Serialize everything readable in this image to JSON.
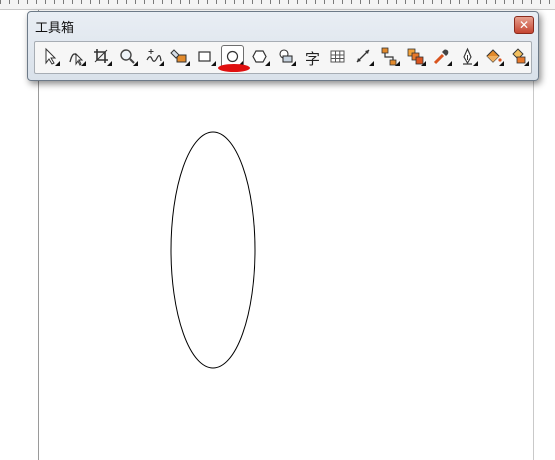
{
  "toolbox": {
    "title": "工具箱",
    "close_label": "✕",
    "active_tool": "ellipse-tool",
    "text_tool_label": "字",
    "tools": [
      {
        "name": "pick-tool",
        "icon": "arrow-pointer-icon"
      },
      {
        "name": "shape-tool",
        "icon": "node-edit-icon"
      },
      {
        "name": "crop-tool",
        "icon": "crop-icon"
      },
      {
        "name": "zoom-tool",
        "icon": "magnifier-icon"
      },
      {
        "name": "freehand-tool",
        "icon": "freehand-curve-icon"
      },
      {
        "name": "smart-fill-tool",
        "icon": "smart-fill-icon"
      },
      {
        "name": "rectangle-tool",
        "icon": "rectangle-icon"
      },
      {
        "name": "ellipse-tool",
        "icon": "ellipse-icon"
      },
      {
        "name": "polygon-tool",
        "icon": "polygon-icon"
      },
      {
        "name": "basic-shapes-tool",
        "icon": "basic-shapes-icon"
      },
      {
        "name": "text-tool",
        "icon": "text-icon"
      },
      {
        "name": "table-tool",
        "icon": "table-grid-icon"
      },
      {
        "name": "dimension-tool",
        "icon": "dimension-line-icon"
      },
      {
        "name": "connector-tool",
        "icon": "connector-icon"
      },
      {
        "name": "blend-tool",
        "icon": "blend-icon"
      },
      {
        "name": "eyedropper-tool",
        "icon": "eyedropper-icon"
      },
      {
        "name": "outline-tool",
        "icon": "pen-nib-icon"
      },
      {
        "name": "fill-tool",
        "icon": "paint-bucket-icon"
      },
      {
        "name": "interactive-fill-tool",
        "icon": "interactive-fill-icon"
      }
    ]
  },
  "colors": {
    "highlight_mark": "#e01010",
    "ellipse_stroke": "#000000"
  }
}
